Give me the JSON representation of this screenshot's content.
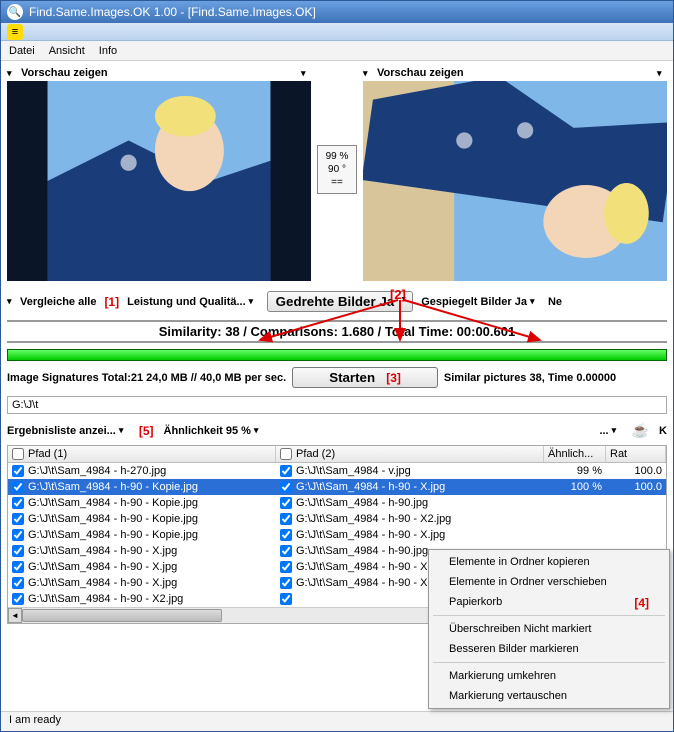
{
  "window": {
    "title": "Find.Same.Images.OK 1.00 - [Find.Same.Images.OK]",
    "inner_title": ""
  },
  "menu": {
    "file": "Datei",
    "view": "Ansicht",
    "info": "Info"
  },
  "preview": {
    "show_label": "Vorschau zeigen"
  },
  "compare_box": {
    "pct": "99 %",
    "rot": "90 °",
    "eq": "=="
  },
  "options": {
    "compare_all": "Vergleiche alle",
    "performance": "Leistung und Qualitä...",
    "rotated": "Gedrehte Bilder Ja",
    "mirrored": "Gespiegelt Bilder Ja",
    "more": "Ne"
  },
  "stats_line": "Similarity: 38 / Comparisons: 1.680 / Total Time: 00:00.601",
  "sig_line": "Image Signatures Total:21  24,0 MB // 40,0 MB per sec.",
  "start_label": "Starten",
  "similar_line": "Similar pictures 38, Time 0.00000",
  "path_value": "G:\\J\\t",
  "filters": {
    "result_list": "Ergebnisliste anzei...",
    "similarity": "Ähnlichkeit 95 %",
    "dots": "...",
    "k": "K"
  },
  "columns": {
    "path1": "Pfad (1)",
    "path2": "Pfad (2)",
    "sim": "Ähnlich...",
    "rat": "Rat"
  },
  "rows": [
    {
      "p1": "G:\\J\\t\\Sam_4984 - h-270.jpg",
      "p2": "G:\\J\\t\\Sam_4984 - v.jpg",
      "sim": "99 %",
      "rt": "100.0",
      "sel": false
    },
    {
      "p1": "G:\\J\\t\\Sam_4984 - h-90 - Kopie.jpg",
      "p2": "G:\\J\\t\\Sam_4984 - h-90 - X.jpg",
      "sim": "100 %",
      "rt": "100.0",
      "sel": true
    },
    {
      "p1": "G:\\J\\t\\Sam_4984 - h-90 - Kopie.jpg",
      "p2": "G:\\J\\t\\Sam_4984 - h-90.jpg",
      "sim": "",
      "rt": "",
      "sel": false
    },
    {
      "p1": "G:\\J\\t\\Sam_4984 - h-90 - Kopie.jpg",
      "p2": "G:\\J\\t\\Sam_4984 - h-90 - X2.jpg",
      "sim": "",
      "rt": "",
      "sel": false
    },
    {
      "p1": "G:\\J\\t\\Sam_4984 - h-90 - Kopie.jpg",
      "p2": "G:\\J\\t\\Sam_4984 - h-90 - X.jpg",
      "sim": "",
      "rt": "",
      "sel": false
    },
    {
      "p1": "G:\\J\\t\\Sam_4984 - h-90 - X.jpg",
      "p2": "G:\\J\\t\\Sam_4984 - h-90.jpg",
      "sim": "",
      "rt": "",
      "sel": false
    },
    {
      "p1": "G:\\J\\t\\Sam_4984 - h-90 - X.jpg",
      "p2": "G:\\J\\t\\Sam_4984 - h-90 - X2.jpg",
      "sim": "",
      "rt": "",
      "sel": false
    },
    {
      "p1": "G:\\J\\t\\Sam_4984 - h-90 - X.jpg",
      "p2": "G:\\J\\t\\Sam_4984 - h-90 - X.jpg",
      "sim": "",
      "rt": "",
      "sel": false
    },
    {
      "p1": "G:\\J\\t\\Sam_4984 - h-90 - X2.jpg",
      "p2": "",
      "sim": "",
      "rt": "",
      "sel": false
    }
  ],
  "context": {
    "copy": "Elemente in Ordner kopieren",
    "move": "Elemente in Ordner verschieben",
    "trash": "Papierkorb",
    "overwrite": "Überschreiben Nicht markiert",
    "mark_better": "Besseren Bilder markieren",
    "invert": "Markierung umkehren",
    "swap": "Markierung vertauschen"
  },
  "footer_status": "I am ready",
  "markers": {
    "m1": "[1]",
    "m2": "[2]",
    "m3": "[3]",
    "m4": "[4]",
    "m5": "[5]"
  }
}
